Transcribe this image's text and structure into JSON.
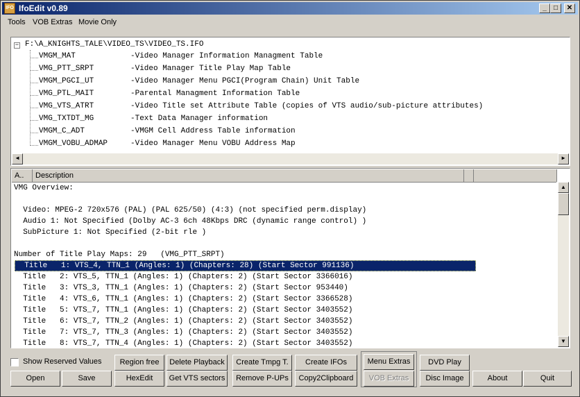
{
  "window": {
    "title": "IfoEdit v0.89",
    "app_icon": "IFO"
  },
  "titlebar_buttons": {
    "minimize": "_",
    "maximize": "□",
    "close": "✕"
  },
  "menu": [
    "Tools",
    "VOB Extras",
    "Movie Only"
  ],
  "tree": {
    "root": "F:\\A_KNIGHTS_TALE\\VIDEO_TS\\VIDEO_TS.IFO",
    "expander": "−",
    "items": [
      {
        "name": "VMGM_MAT",
        "desc": "-Video Manager Information Managment Table"
      },
      {
        "name": "VMG_PTT_SRPT",
        "desc": "-Video Manager Title Play Map Table"
      },
      {
        "name": "VMGM_PGCI_UT",
        "desc": "-Video Manager Menu PGCI(Program Chain) Unit Table"
      },
      {
        "name": "VMG_PTL_MAIT",
        "desc": "-Parental Managment Information Table"
      },
      {
        "name": "VMG_VTS_ATRT",
        "desc": "-Video Title set Attribute Table (copies of VTS audio/sub-picture attributes)"
      },
      {
        "name": "VMG_TXTDT_MG",
        "desc": "-Text Data Manager information"
      },
      {
        "name": "VMGM_C_ADT",
        "desc": "-VMGM Cell Address Table information"
      },
      {
        "name": "VMGM_VOBU_ADMAP",
        "desc": "-Video Manager Menu VOBU Address Map"
      }
    ]
  },
  "scroll": {
    "left": "◀",
    "right": "▶",
    "up": "▲",
    "down": "▼"
  },
  "desc_list": {
    "columns": [
      "A..",
      "Description"
    ],
    "lines": [
      "VMG Overview:",
      "",
      "  Video: MPEG-2 720x576 (PAL) (PAL 625/50) (4:3) (not specified perm.display)",
      "  Audio 1: Not Specified (Dolby AC-3 6ch 48Kbps DRC (dynamic range control) )",
      "  SubPicture 1: Not Specified (2-bit rle )",
      "",
      "Number of Title Play Maps: 29   (VMG_PTT_SRPT)",
      "  Title   1: VTS_4, TTN_1 (Angles: 1) (Chapters: 28) (Start Sector 991136)",
      "  Title   2: VTS_5, TTN_1 (Angles: 1) (Chapters: 2) (Start Sector 3366016)",
      "  Title   3: VTS_3, TTN_1 (Angles: 1) (Chapters: 2) (Start Sector 953440)",
      "  Title   4: VTS_6, TTN_1 (Angles: 1) (Chapters: 2) (Start Sector 3366528)",
      "  Title   5: VTS_7, TTN_1 (Angles: 1) (Chapters: 2) (Start Sector 3403552)",
      "  Title   6: VTS_7, TTN_2 (Angles: 1) (Chapters: 2) (Start Sector 3403552)",
      "  Title   7: VTS_7, TTN_3 (Angles: 1) (Chapters: 2) (Start Sector 3403552)",
      "  Title   8: VTS_7, TTN_4 (Angles: 1) (Chapters: 2) (Start Sector 3403552)"
    ],
    "selected_index": 7
  },
  "controls": {
    "show_reserved": {
      "label": "Show Reserved Values",
      "checked": false
    },
    "buttons": {
      "region_free": "Region free",
      "delete_playback": "Delete Playback",
      "create_tmpg": "Create Tmpg T.",
      "create_ifos": "Create IFOs",
      "menu_extras": "Menu Extras",
      "dvd_play": "DVD Play",
      "open": "Open",
      "save": "Save",
      "hexedit": "HexEdit",
      "get_vts_sectors": "Get VTS sectors",
      "remove_pups": "Remove P-UPs",
      "copy2clipboard": "Copy2Clipboard",
      "vob_extras": "VOB Extras",
      "disc_image": "Disc Image",
      "about": "About",
      "quit": "Quit"
    }
  }
}
